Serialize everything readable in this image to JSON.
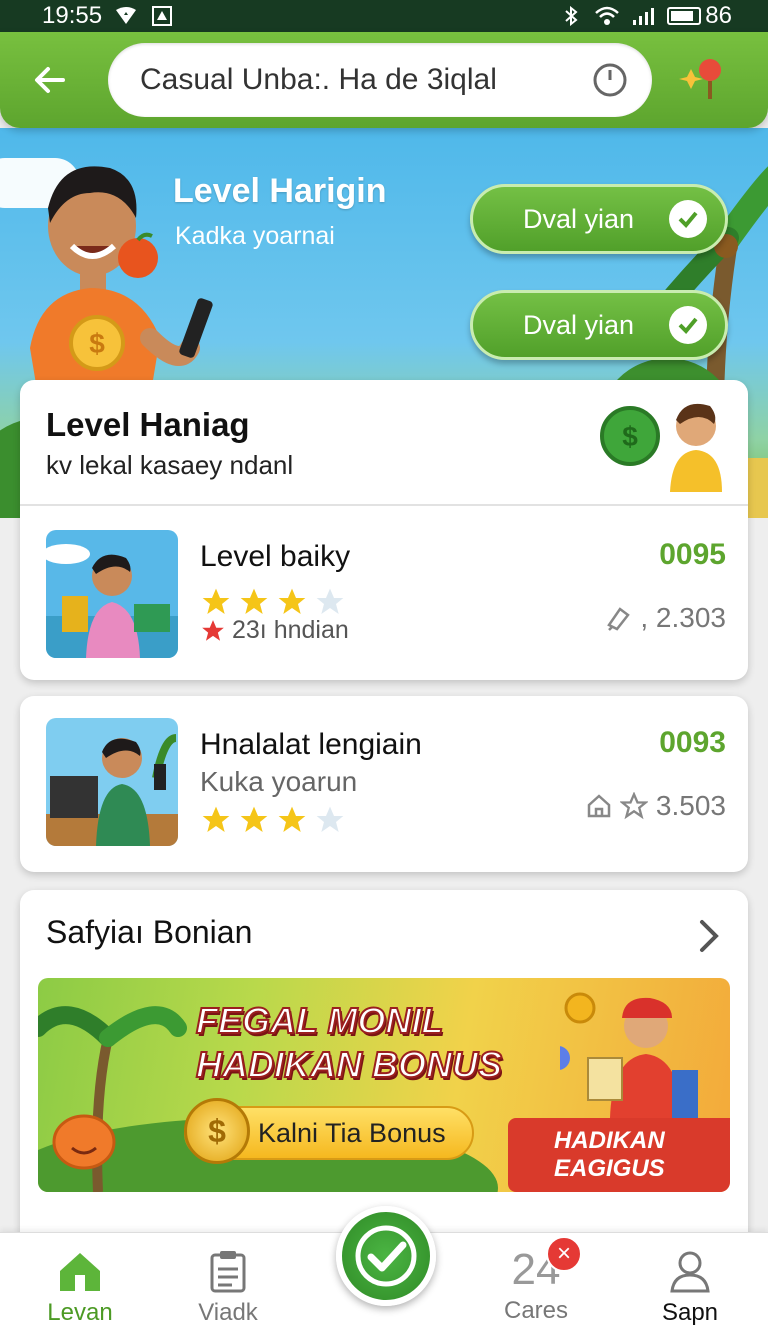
{
  "status_bar": {
    "time": "19:55",
    "battery": "86",
    "battery_level": 0.86
  },
  "header": {
    "search_text": "Casual Unba:. Ha de 3iqlal",
    "icons": [
      "back-arrow-icon",
      "clock-icon",
      "map-pin-icon"
    ]
  },
  "hero": {
    "title": "Level Harigin",
    "subtitle": "Kadka yoarnai",
    "buttons": [
      {
        "label": "Dval yian"
      },
      {
        "label": "Dval yian"
      }
    ]
  },
  "main_card": {
    "title": "Level Haniag",
    "description": "kv lekal kasaey ndanl",
    "items": [
      {
        "name": "Level baiky",
        "stars": 3,
        "rating_text": "23ı hndian",
        "price": "0095",
        "stat": ", 2.303"
      }
    ]
  },
  "second_card": {
    "item": {
      "name": "Hnalalat lengiain",
      "subtitle": "Kuka yoarun",
      "stars": 3,
      "price": "0093",
      "stat": "3.503"
    }
  },
  "bonus_card": {
    "title": "Safyiaı Bonian",
    "banner": {
      "line1": "FEGAL MONIL",
      "line2": "HADIKAN BONUS",
      "cta": "Kalni Tia Bonus",
      "side_line1": "HADIKAN",
      "side_line2": "EAGIGUS"
    }
  },
  "bottom_nav": {
    "items": [
      {
        "label": "Levan",
        "icon": "home-icon"
      },
      {
        "label": "Viadk",
        "icon": "clipboard-icon"
      },
      {
        "label": "Cares",
        "icon": "count-icon",
        "count": "24"
      },
      {
        "label": "Sapn",
        "icon": "user-icon"
      }
    ],
    "badge": "×"
  },
  "colors": {
    "accent_green": "#5da52e",
    "header_green": "#78c03f",
    "badge_red": "#e53935"
  }
}
